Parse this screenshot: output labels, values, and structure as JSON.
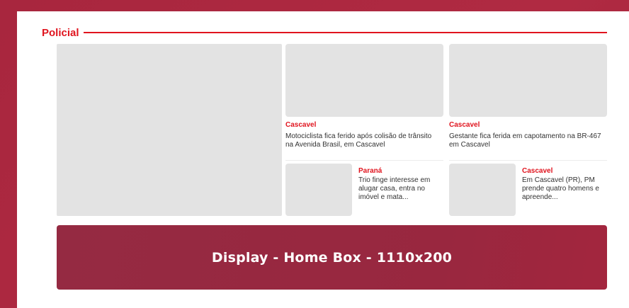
{
  "section": {
    "title": "Policial"
  },
  "cards": [
    {
      "tag": "Cascavel",
      "headline": "Motociclista fica ferido após colisão de trânsito na Avenida Brasil, em Cascavel"
    },
    {
      "tag": "Cascavel",
      "headline": "Gestante fica ferida em capotamento na BR-467 em Cascavel"
    }
  ],
  "small_cards": [
    {
      "tag": "Paraná",
      "headline": "Trio finge interesse em alugar casa, entra no imóvel e mata..."
    },
    {
      "tag": "Cascavel",
      "headline": "Em Cascavel (PR), PM prende quatro homens e apreende..."
    }
  ],
  "banner": {
    "label": "Display - Home Box - 1110x200"
  },
  "colors": {
    "accent": "#e0141e",
    "background": "#a8263e",
    "banner": "#952a42",
    "placeholder": "#e3e3e3"
  }
}
